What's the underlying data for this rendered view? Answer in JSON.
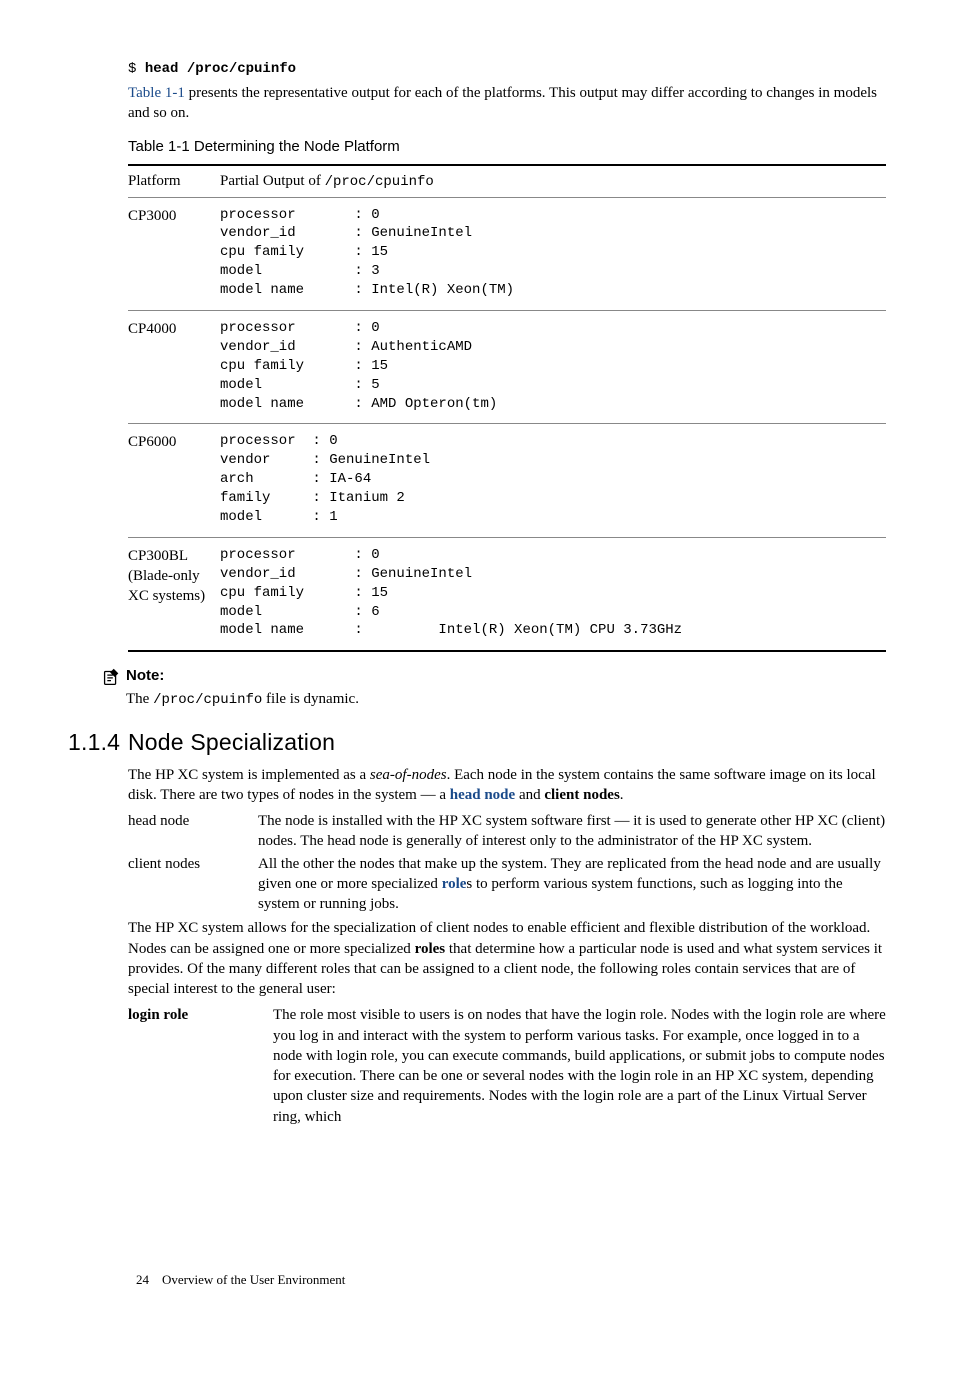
{
  "cmd": {
    "prompt": "$ ",
    "command": "head /proc/cpuinfo"
  },
  "intro": {
    "link": "Table 1-1",
    "rest": " presents the representative output for each of the platforms. This output may differ according to changes in models and so on."
  },
  "table": {
    "caption": "Table  1-1  Determining the Node Platform",
    "header": {
      "col1": "Platform",
      "col2a": "Partial Output of ",
      "col2b": "/proc/cpuinfo"
    },
    "rows": [
      {
        "platform": "CP3000",
        "output": "processor       : 0\nvendor_id       : GenuineIntel\ncpu family      : 15\nmodel           : 3\nmodel name      : Intel(R) Xeon(TM)"
      },
      {
        "platform": "CP4000",
        "output": "processor       : 0\nvendor_id       : AuthenticAMD\ncpu family      : 15\nmodel           : 5\nmodel name      : AMD Opteron(tm)"
      },
      {
        "platform": "CP6000",
        "output": "processor  : 0\nvendor     : GenuineIntel\narch       : IA-64\nfamily     : Itanium 2\nmodel      : 1"
      },
      {
        "platform": "CP300BL (Blade-only XC systems)",
        "output": "processor       : 0\nvendor_id       : GenuineIntel\ncpu family      : 15\nmodel           : 6\nmodel name      :         Intel(R) Xeon(TM) CPU 3.73GHz"
      }
    ]
  },
  "note": {
    "title": "Note:",
    "textA": "The ",
    "code": "/proc/cpuinfo",
    "textB": " file is dynamic."
  },
  "section": {
    "number": "1.1.4",
    "title": "Node Specialization"
  },
  "para1": {
    "a": "The HP XC system is implemented as a ",
    "b": "sea-of-nodes",
    "c": ". Each node in the system contains the same software image on its local disk. There are two types of nodes in the system — a ",
    "d": "head node",
    "e": " and ",
    "f": "client nodes",
    "g": "."
  },
  "defs1": [
    {
      "term": "head node",
      "def": "The node is installed with the HP XC system software first — it is used to generate other HP XC (client) nodes. The head node is generally of interest only to the administrator of the HP XC system."
    },
    {
      "term": "client nodes",
      "defA": "All the other the nodes that make up the system. They are replicated from the head node and are usually given one or more specialized ",
      "defLink": "role",
      "defB": "s to perform various system functions, such as logging into the system or running jobs."
    }
  ],
  "para2": {
    "a": "The HP XC system allows for the specialization of client nodes to enable efficient and flexible distribution of the workload. Nodes can be assigned one or more specialized ",
    "b": "roles",
    "c": " that determine how a particular node is used and what system services it provides. Of the many different roles that can be assigned to a client node, the following roles contain services that are of special interest to the general user:"
  },
  "defs2": [
    {
      "term": "login role",
      "def": "The role most visible to users is on nodes that have the login role. Nodes with the login role are where you log in and interact with the system to perform various tasks. For example, once logged in to a node with login role, you can execute commands, build applications, or submit jobs to compute nodes for execution. There can be one or several nodes with the login role in an HP XC system, depending upon cluster size and requirements. Nodes with the login role are a part of the Linux Virtual Server ring, which"
    }
  ],
  "footer": {
    "page": "24",
    "title": "Overview of the User Environment"
  }
}
